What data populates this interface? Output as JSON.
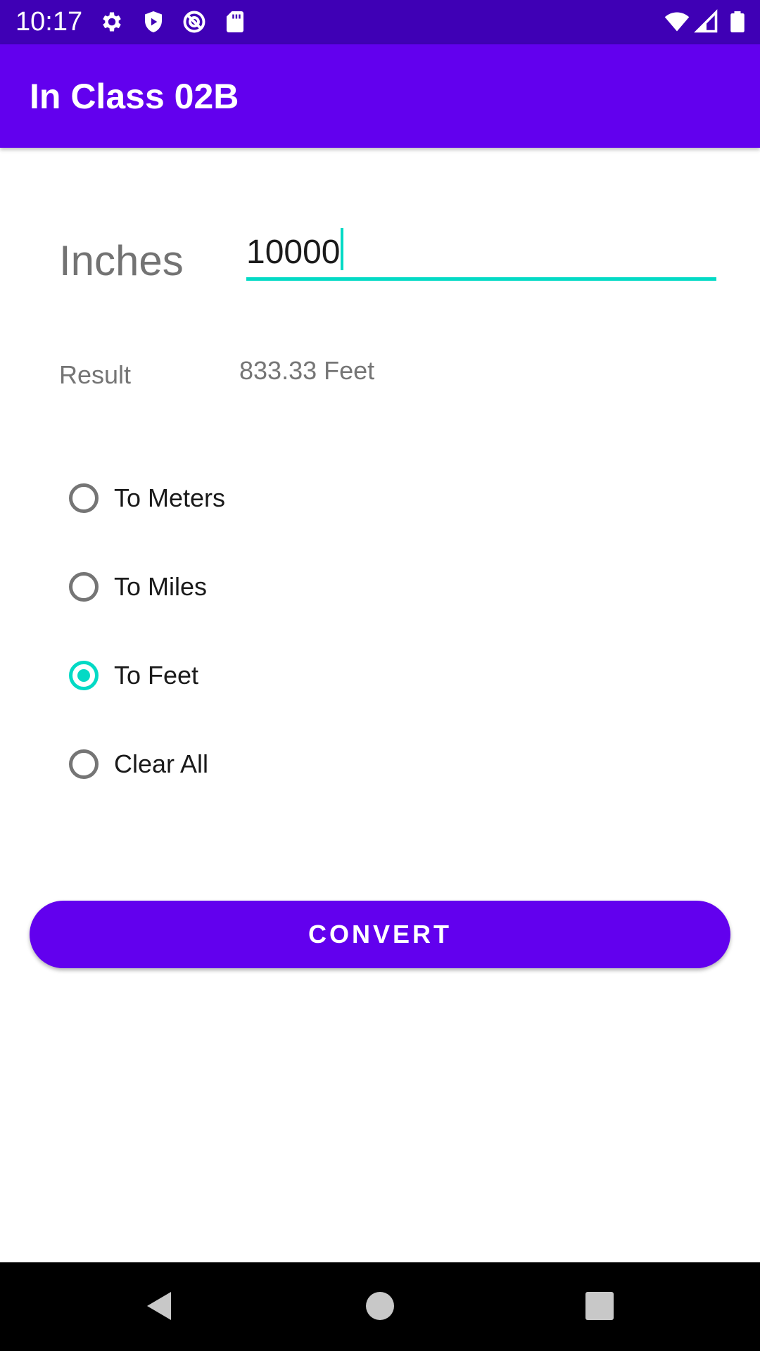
{
  "status_bar": {
    "time": "10:17",
    "left_icons": [
      "gear-icon",
      "shield-icon",
      "vpn-icon",
      "sd-card-icon"
    ],
    "right_icons": [
      "wifi-icon",
      "signal-icon",
      "battery-icon"
    ]
  },
  "app_bar": {
    "title": "In Class 02B"
  },
  "form": {
    "input_label": "Inches",
    "input_value": "10000",
    "result_label": "Result",
    "result_value": "833.33 Feet"
  },
  "options": [
    {
      "label": "To Meters",
      "checked": false
    },
    {
      "label": "To Miles",
      "checked": false
    },
    {
      "label": "To Feet",
      "checked": true
    },
    {
      "label": "Clear All",
      "checked": false
    }
  ],
  "convert_label": "CONVERT",
  "nav_bar": {
    "buttons": [
      "back-icon",
      "home-icon",
      "recents-icon"
    ]
  },
  "colors": {
    "status_bar": "#3f00b5",
    "primary": "#6200ee",
    "accent": "#03dac5",
    "nav_bar": "#000000"
  }
}
